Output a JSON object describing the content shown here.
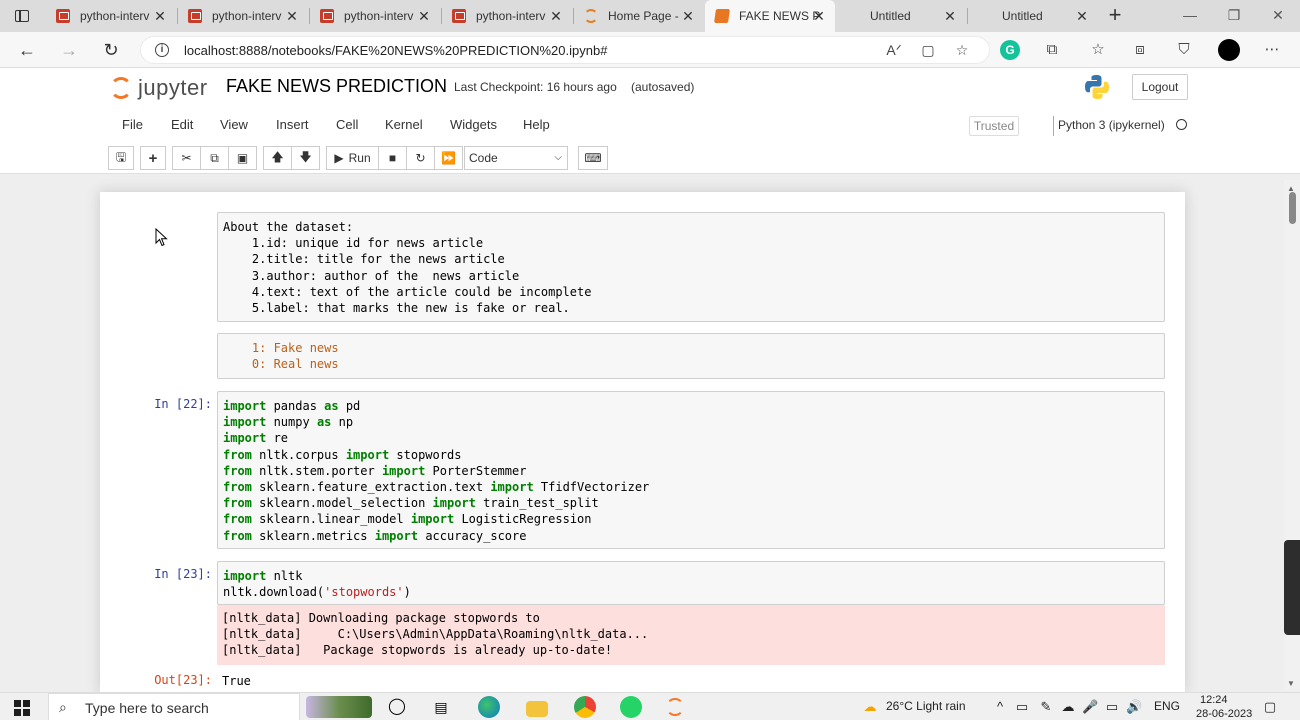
{
  "browser": {
    "tabs": [
      {
        "title": "python-interv",
        "icon": "pdf-icon",
        "active": false
      },
      {
        "title": "python-interv",
        "icon": "pdf-icon",
        "active": false
      },
      {
        "title": "python-interv",
        "icon": "pdf-icon",
        "active": false
      },
      {
        "title": "python-interv",
        "icon": "pdf-icon",
        "active": false
      },
      {
        "title": "Home Page - ",
        "icon": "jupyter-icon",
        "active": false
      },
      {
        "title": "FAKE NEWS P",
        "icon": "book-icon",
        "active": true
      },
      {
        "title": "Untitled",
        "icon": "none",
        "active": false
      },
      {
        "title": "Untitled",
        "icon": "none",
        "active": false
      }
    ],
    "url": "localhost:8888/notebooks/FAKE%20NEWS%20PREDICTION%20.ipynb#"
  },
  "jupyter": {
    "logo_text": "jupyter",
    "notebook_name": "FAKE NEWS PREDICTION",
    "checkpoint": "Last Checkpoint: 16 hours ago",
    "autosave": "(autosaved)",
    "logout": "Logout",
    "menu": [
      "File",
      "Edit",
      "View",
      "Insert",
      "Cell",
      "Kernel",
      "Widgets",
      "Help"
    ],
    "trusted": "Trusted",
    "kernel": "Python 3 (ipykernel)",
    "toolbar": {
      "run_label": "Run",
      "cell_type": "Code"
    }
  },
  "cells": {
    "markdown1": {
      "lines": [
        "About the dataset:",
        "    1.id: unique id for news article",
        "    2.title: title for the news article",
        "    3.author: author of the  news article",
        "    4.text: text of the article could be incomplete",
        "    5.label: that marks the new is fake or real."
      ]
    },
    "markdown2": {
      "lines": [
        "    1: Fake news",
        "    0: Real news"
      ]
    },
    "code22": {
      "prompt": "In [22]:"
    },
    "code23": {
      "prompt": "In [23]:",
      "stderr": [
        "[nltk_data] Downloading package stopwords to",
        "[nltk_data]     C:\\Users\\Admin\\AppData\\Roaming\\nltk_data...",
        "[nltk_data]   Package stopwords is already up-to-date!"
      ],
      "out_prompt": "Out[23]:",
      "out_value": "True"
    }
  },
  "taskbar": {
    "search_placeholder": "Type here to search",
    "weather": "26°C  Light rain",
    "language": "ENG",
    "time": "12:24",
    "date": "28-06-2023"
  }
}
